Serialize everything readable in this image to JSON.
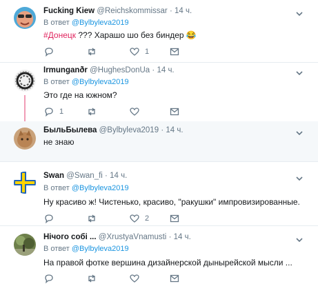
{
  "reply_prefix": "В ответ",
  "reply_target": "@Bylbyleva2019",
  "tweets": [
    {
      "name": "Fucking Kiew",
      "handle": "@Reichskommissar",
      "time": "14 ч.",
      "hashtag": "#Донецк",
      "text": " ??? Харашо шо без биндер 😂",
      "replies": "",
      "retweets": "",
      "likes": "1"
    },
    {
      "name": "Irmunganðr",
      "handle": "@HughesDonUa",
      "time": "14 ч.",
      "text": "Это где на южном?",
      "replies": "1",
      "retweets": "",
      "likes": ""
    },
    {
      "name": "БыльБылева",
      "handle": "@Bylbyleva2019",
      "time": "14 ч.",
      "text": "не знаю"
    },
    {
      "name": "Swan",
      "handle": "@Swan_fi",
      "time": "14 ч.",
      "text": "Ну красиво ж! Чистенько, красиво, \"ракушки\" импровизированные.",
      "replies": "",
      "retweets": "",
      "likes": "2"
    },
    {
      "name": "Нічого собі ...",
      "handle": "@XrustyaVnamusti",
      "time": "14 ч.",
      "text": "На правой фотке вершина дизайнерской дынырейской мысли ...",
      "replies": "",
      "retweets": "",
      "likes": ""
    }
  ]
}
